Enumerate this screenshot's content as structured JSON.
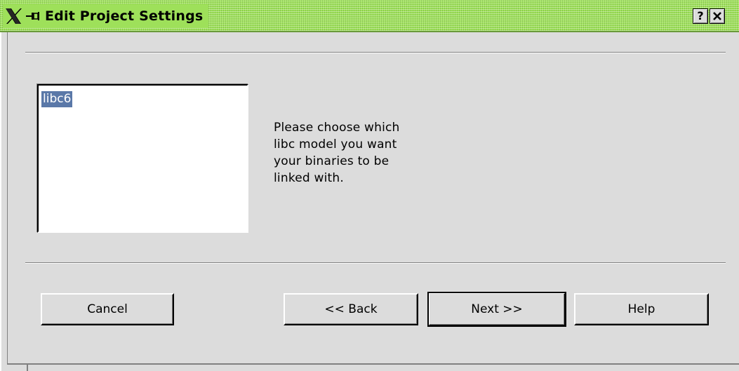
{
  "window": {
    "title": "Edit Project Settings",
    "help_button": "?",
    "close_button": "✕",
    "titlebar_color": "#9ee05a"
  },
  "list": {
    "items": [
      "libc6"
    ],
    "selected": "libc6",
    "selection_color": "#5a78a8"
  },
  "description": {
    "lines": [
      "Please choose which",
      "libc model you want",
      "your binaries to be",
      "linked with."
    ]
  },
  "buttons": {
    "cancel": "Cancel",
    "back": "<< Back",
    "next": "Next >>",
    "help": "Help"
  }
}
